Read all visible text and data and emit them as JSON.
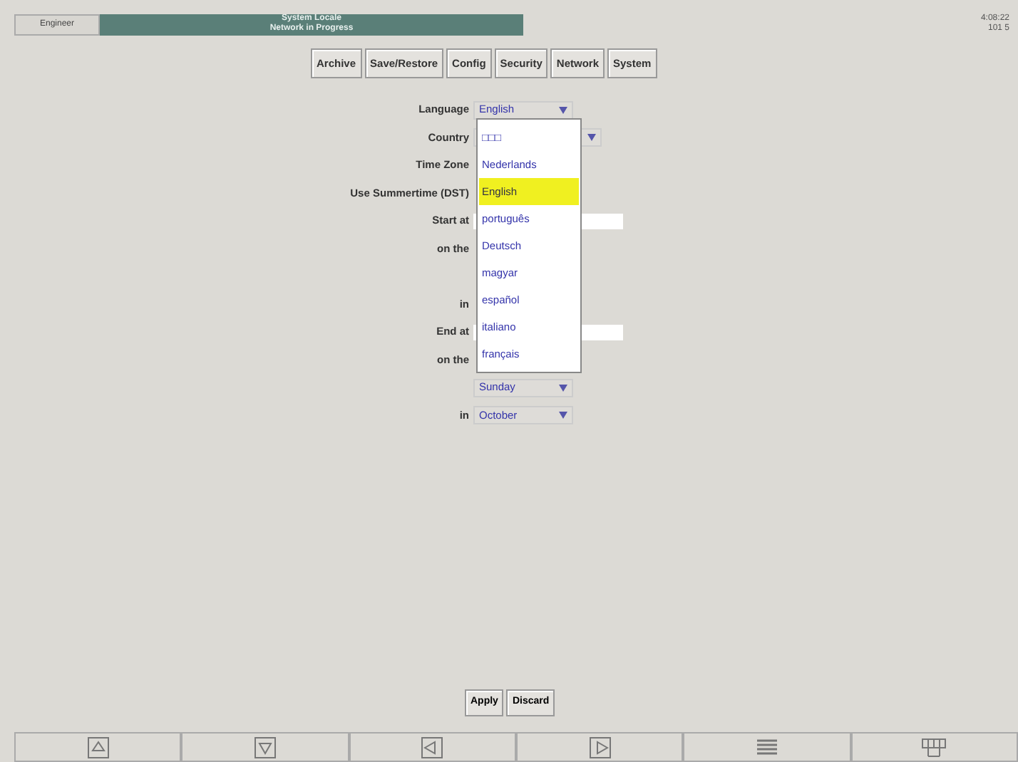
{
  "header": {
    "user": "Engineer",
    "title": "System Locale",
    "subtitle": "Network in Progress",
    "clock": "4:08:22",
    "code": "101 5"
  },
  "tabs": [
    {
      "label": "Archive",
      "selected": false
    },
    {
      "label": "Save/Restore",
      "selected": false
    },
    {
      "label": "Config",
      "selected": false
    },
    {
      "label": "Security",
      "selected": false
    },
    {
      "label": "Network",
      "selected": false
    },
    {
      "label": "System",
      "selected": false
    }
  ],
  "form": [
    {
      "label": "Language",
      "kind": "select",
      "value": "English"
    },
    {
      "label": "Country",
      "kind": "select"
    },
    {
      "label": "Time Zone",
      "kind": "none"
    },
    {
      "label": "Use Summertime (DST)",
      "kind": "none"
    },
    {
      "label": "Start at",
      "kind": "input"
    },
    {
      "label": "on the",
      "kind": "none"
    },
    {
      "kind": "none"
    },
    {
      "label": "in",
      "kind": "none"
    },
    {
      "label": "End at",
      "kind": "input"
    },
    {
      "label": "on the",
      "kind": "none"
    },
    {
      "kind": "select",
      "value": "Sunday"
    },
    {
      "label": "in",
      "kind": "select",
      "value": "October"
    }
  ],
  "dropdown": [
    {
      "label": "□□□",
      "selected": false
    },
    {
      "label": "Nederlands",
      "selected": false
    },
    {
      "label": "English",
      "selected": true
    },
    {
      "label": "português",
      "selected": false
    },
    {
      "label": "Deutsch",
      "selected": false
    },
    {
      "label": "magyar",
      "selected": false
    },
    {
      "label": "español",
      "selected": false
    },
    {
      "label": "italiano",
      "selected": false
    },
    {
      "label": "français",
      "selected": false
    }
  ],
  "buttons": [
    "Apply",
    "Discard"
  ],
  "toolbar": [
    {
      "kind": "up"
    },
    {
      "kind": "down"
    },
    {
      "kind": "left"
    },
    {
      "kind": "right"
    },
    {
      "kind": "lines"
    },
    {
      "kind": "grid"
    }
  ]
}
